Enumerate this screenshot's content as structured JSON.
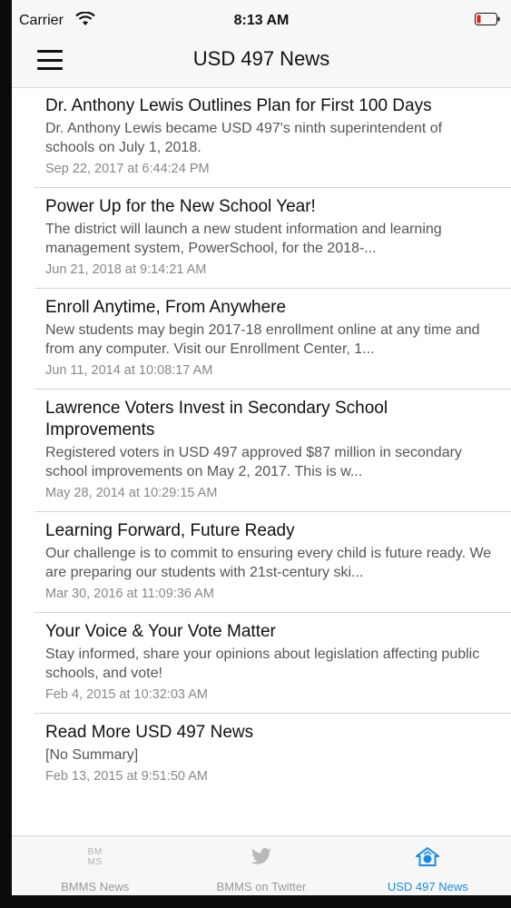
{
  "status": {
    "carrier": "Carrier",
    "time": "8:13 AM"
  },
  "navbar": {
    "title": "USD 497 News"
  },
  "news": [
    {
      "title": "Dr. Anthony Lewis Outlines Plan for First 100 Days",
      "summary": "Dr. Anthony Lewis became USD 497's ninth superintendent of schools on July 1, 2018.",
      "date": "Sep 22, 2017 at 6:44:24 PM"
    },
    {
      "title": "Power Up for the New School Year!",
      "summary": "The district will launch a new student information and learning management system, PowerSchool, for the 2018-...",
      "date": "Jun 21, 2018 at 9:14:21 AM"
    },
    {
      "title": "Enroll Anytime, From Anywhere",
      "summary": "New students may begin 2017-18 enrollment online at any time and from any computer. Visit our Enrollment Center, 1...",
      "date": "Jun 11, 2014 at 10:08:17 AM"
    },
    {
      "title": "Lawrence Voters Invest in Secondary School Improvements",
      "summary": "Registered voters in USD 497 approved $87 million in secondary school improvements on May 2, 2017. This is w...",
      "date": "May 28, 2014 at 10:29:15 AM"
    },
    {
      "title": "Learning Forward, Future Ready",
      "summary": "Our challenge is to commit to ensuring every child is future ready. We are preparing our students with 21st-century ski...",
      "date": "Mar 30, 2016 at 11:09:36 AM"
    },
    {
      "title": "Your Voice & Your Vote Matter",
      "summary": "Stay informed, share your opinions about legislation affecting public schools, and vote!",
      "date": "Feb 4, 2015 at 10:32:03 AM"
    },
    {
      "title": "Read More USD 497 News",
      "summary": "[No Summary]",
      "date": "Feb 13, 2015 at 9:51:50 AM"
    }
  ],
  "tabbar": {
    "tabs": [
      {
        "label": "BMMS News",
        "icon": "bmms-logo-icon",
        "logo_line1": "BM",
        "logo_line2": "MS"
      },
      {
        "label": "BMMS on Twitter",
        "icon": "twitter-bird-icon"
      },
      {
        "label": "USD 497 News",
        "icon": "district-logo-icon"
      }
    ],
    "active_color": "#1a8de0",
    "inactive_color": "#999999"
  }
}
